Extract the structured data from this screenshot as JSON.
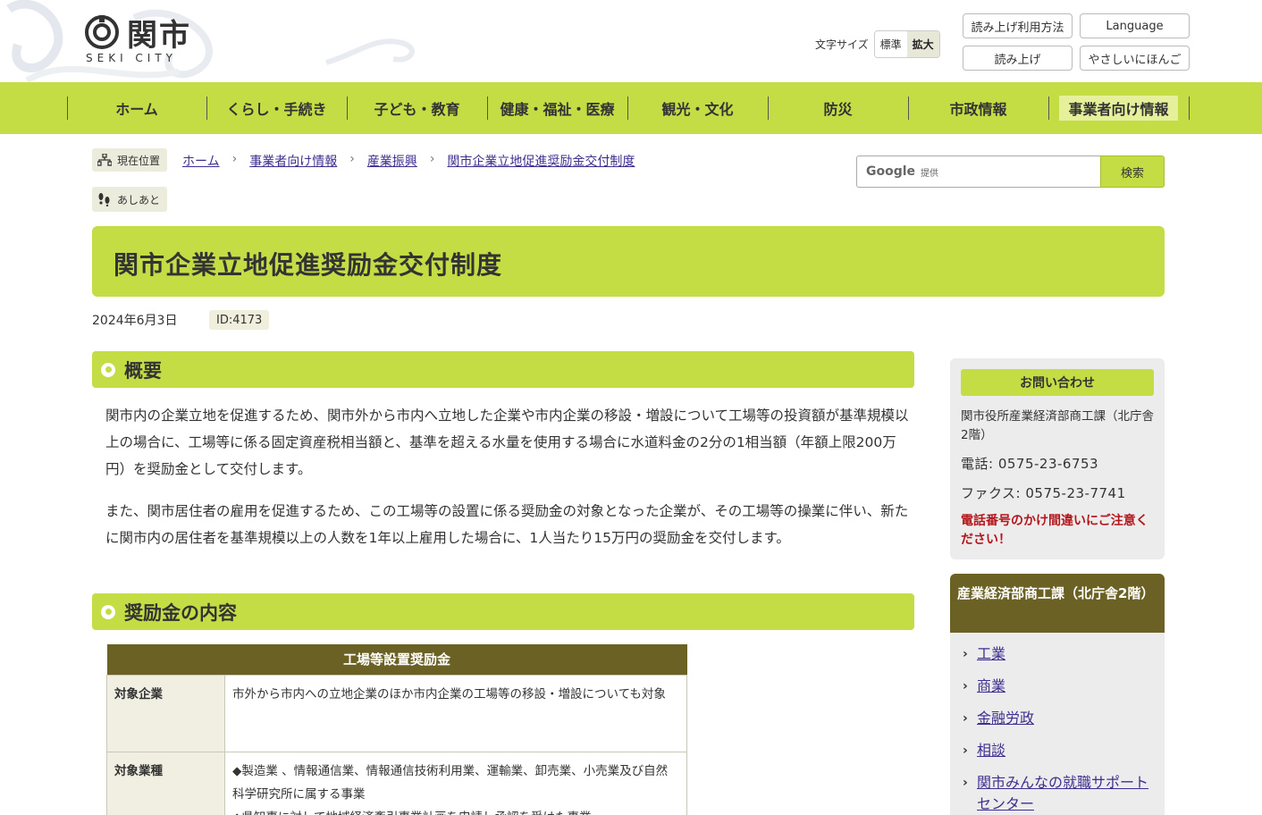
{
  "header": {
    "logo_text": "関市",
    "logo_sub": "SEKI CITY",
    "fontsize_label": "文字サイズ",
    "fontsize_standard": "標準",
    "fontsize_large": "拡大",
    "readout_howto": "読み上げ利用方法",
    "language": "Language",
    "readout": "読み上げ",
    "easy_japanese": "やさしいにほんご"
  },
  "nav": {
    "items": [
      {
        "label": "ホーム"
      },
      {
        "label": "くらし・手続き"
      },
      {
        "label": "子ども・教育"
      },
      {
        "label": "健康・福祉・医療"
      },
      {
        "label": "観光・文化"
      },
      {
        "label": "防災"
      },
      {
        "label": "市政情報"
      },
      {
        "label": "事業者向け情報"
      }
    ]
  },
  "breadcrumb": {
    "current_label": "現在位置",
    "items": [
      "ホーム",
      "事業者向け情報",
      "産業振興",
      "関市企業立地促進奨励金交付制度"
    ],
    "footsteps_label": "あしあと"
  },
  "search": {
    "google": "Google",
    "provided": "提供",
    "button": "検索"
  },
  "page": {
    "title": "関市企業立地促進奨励金交付制度",
    "date": "2024年6月3日",
    "id": "ID:4173"
  },
  "sections": {
    "overview_heading": "概要",
    "overview_p1": "関市内の企業立地を促進するため、関市外から市内へ立地した企業や市内企業の移設・増設について工場等の投資額が基準規模以上の場合に、工場等に係る固定資産税相当額と、基準を超える水量を使用する場合に水道料金の2分の1相当額（年額上限200万円）を奨励金として交付します。",
    "overview_p2": "また、関市居住者の雇用を促進するため、この工場等の設置に係る奨励金の対象となった企業が、その工場等の操業に伴い、新たに関市内の居住者を基準規模以上の人数を1年以上雇用した場合に、1人当たり15万円の奨励金を交付します。",
    "content_heading": "奨励金の内容"
  },
  "table": {
    "caption": "工場等設置奨励金",
    "rows": [
      {
        "key": "対象企業",
        "value": "市外から市内への立地企業のほか市内企業の工場等の移設・増設についても対象"
      },
      {
        "key": "対象業種",
        "value": "◆製造業 、情報通信業、情報通信技術利用業、運輸業、卸売業、小売業及び自然科学研究所に属する事業",
        "value2": "◆県知事に対して地域経済牽引事業計画を申請し承認を受けた事業"
      }
    ]
  },
  "contact": {
    "heading": "お問い合わせ",
    "dept": "関市役所産業経済部商工課（北庁舎2階）",
    "tel": "電話: 0575-23-6753",
    "fax": "ファクス: 0575-23-7741",
    "warning": "電話番号のかけ間違いにご注意ください！"
  },
  "dept_menu": {
    "heading": "産業経済部商工課（北庁舎2階）",
    "items": [
      "工業",
      "商業",
      "金融労政",
      "相談",
      "関市みんなの就職サポートセンター"
    ]
  }
}
